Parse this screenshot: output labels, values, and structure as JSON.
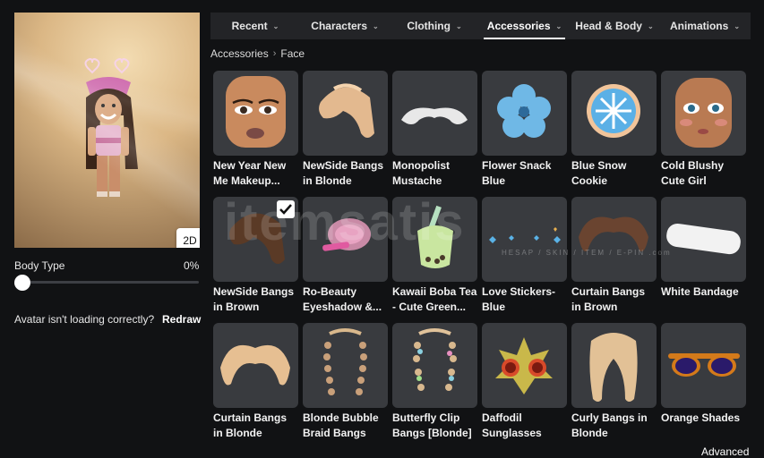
{
  "tabs": [
    {
      "label": "Recent",
      "active": false
    },
    {
      "label": "Characters",
      "active": false
    },
    {
      "label": "Clothing",
      "active": false
    },
    {
      "label": "Accessories",
      "active": true
    },
    {
      "label": "Head & Body",
      "active": false
    },
    {
      "label": "Animations",
      "active": false
    }
  ],
  "breadcrumb": {
    "parent": "Accessories",
    "current": "Face"
  },
  "avatar": {
    "toggle_2d": "2D"
  },
  "body_type": {
    "label": "Body Type",
    "value": "0%"
  },
  "loading": {
    "text": "Avatar isn't loading correctly?",
    "link": "Redraw"
  },
  "items": [
    {
      "name": "New Year New Me Makeup...",
      "icon": "face-makeup-icon"
    },
    {
      "name": "NewSide Bangs in Blonde",
      "icon": "blonde-bangs-icon"
    },
    {
      "name": "Monopolist Mustache",
      "icon": "mustache-icon"
    },
    {
      "name": "Flower Snack Blue",
      "icon": "blue-flower-icon"
    },
    {
      "name": "Blue Snow Cookie",
      "icon": "snow-cookie-icon"
    },
    {
      "name": "Cold Blushy Cute Girl",
      "icon": "face-blush-icon"
    },
    {
      "name": "NewSide Bangs in Brown",
      "icon": "brown-bangs-icon",
      "equipped": true
    },
    {
      "name": "Ro-Beauty Eyeshadow &...",
      "icon": "eyeshadow-icon"
    },
    {
      "name": "Kawaii Boba Tea - Cute Green...",
      "icon": "boba-tea-icon"
    },
    {
      "name": "Love Stickers-Blue",
      "icon": "love-stickers-icon"
    },
    {
      "name": "Curtain Bangs in Brown",
      "icon": "brown-curtain-bangs-icon"
    },
    {
      "name": "White Bandage",
      "icon": "bandage-icon"
    },
    {
      "name": "Curtain Bangs in Blonde",
      "icon": "blonde-curtain-bangs-icon"
    },
    {
      "name": "Blonde Bubble Braid Bangs",
      "icon": "braid-bangs-icon"
    },
    {
      "name": "Butterfly Clip Bangs [Blonde]",
      "icon": "butterfly-clip-icon"
    },
    {
      "name": "Daffodil Sunglasses",
      "icon": "daffodil-sunglasses-icon"
    },
    {
      "name": "Curly Bangs in Blonde",
      "icon": "curly-bangs-icon"
    },
    {
      "name": "Orange Shades",
      "icon": "orange-shades-icon"
    }
  ],
  "footer": {
    "advanced": "Advanced"
  },
  "watermark": {
    "text": "itemsatis",
    "sub": "HESAP / SKIN / ITEM / E-PIN .com"
  },
  "colors": {
    "background": "#111214",
    "tabbar": "#232427",
    "card": "#393b3f",
    "accent": "#ffffff"
  }
}
